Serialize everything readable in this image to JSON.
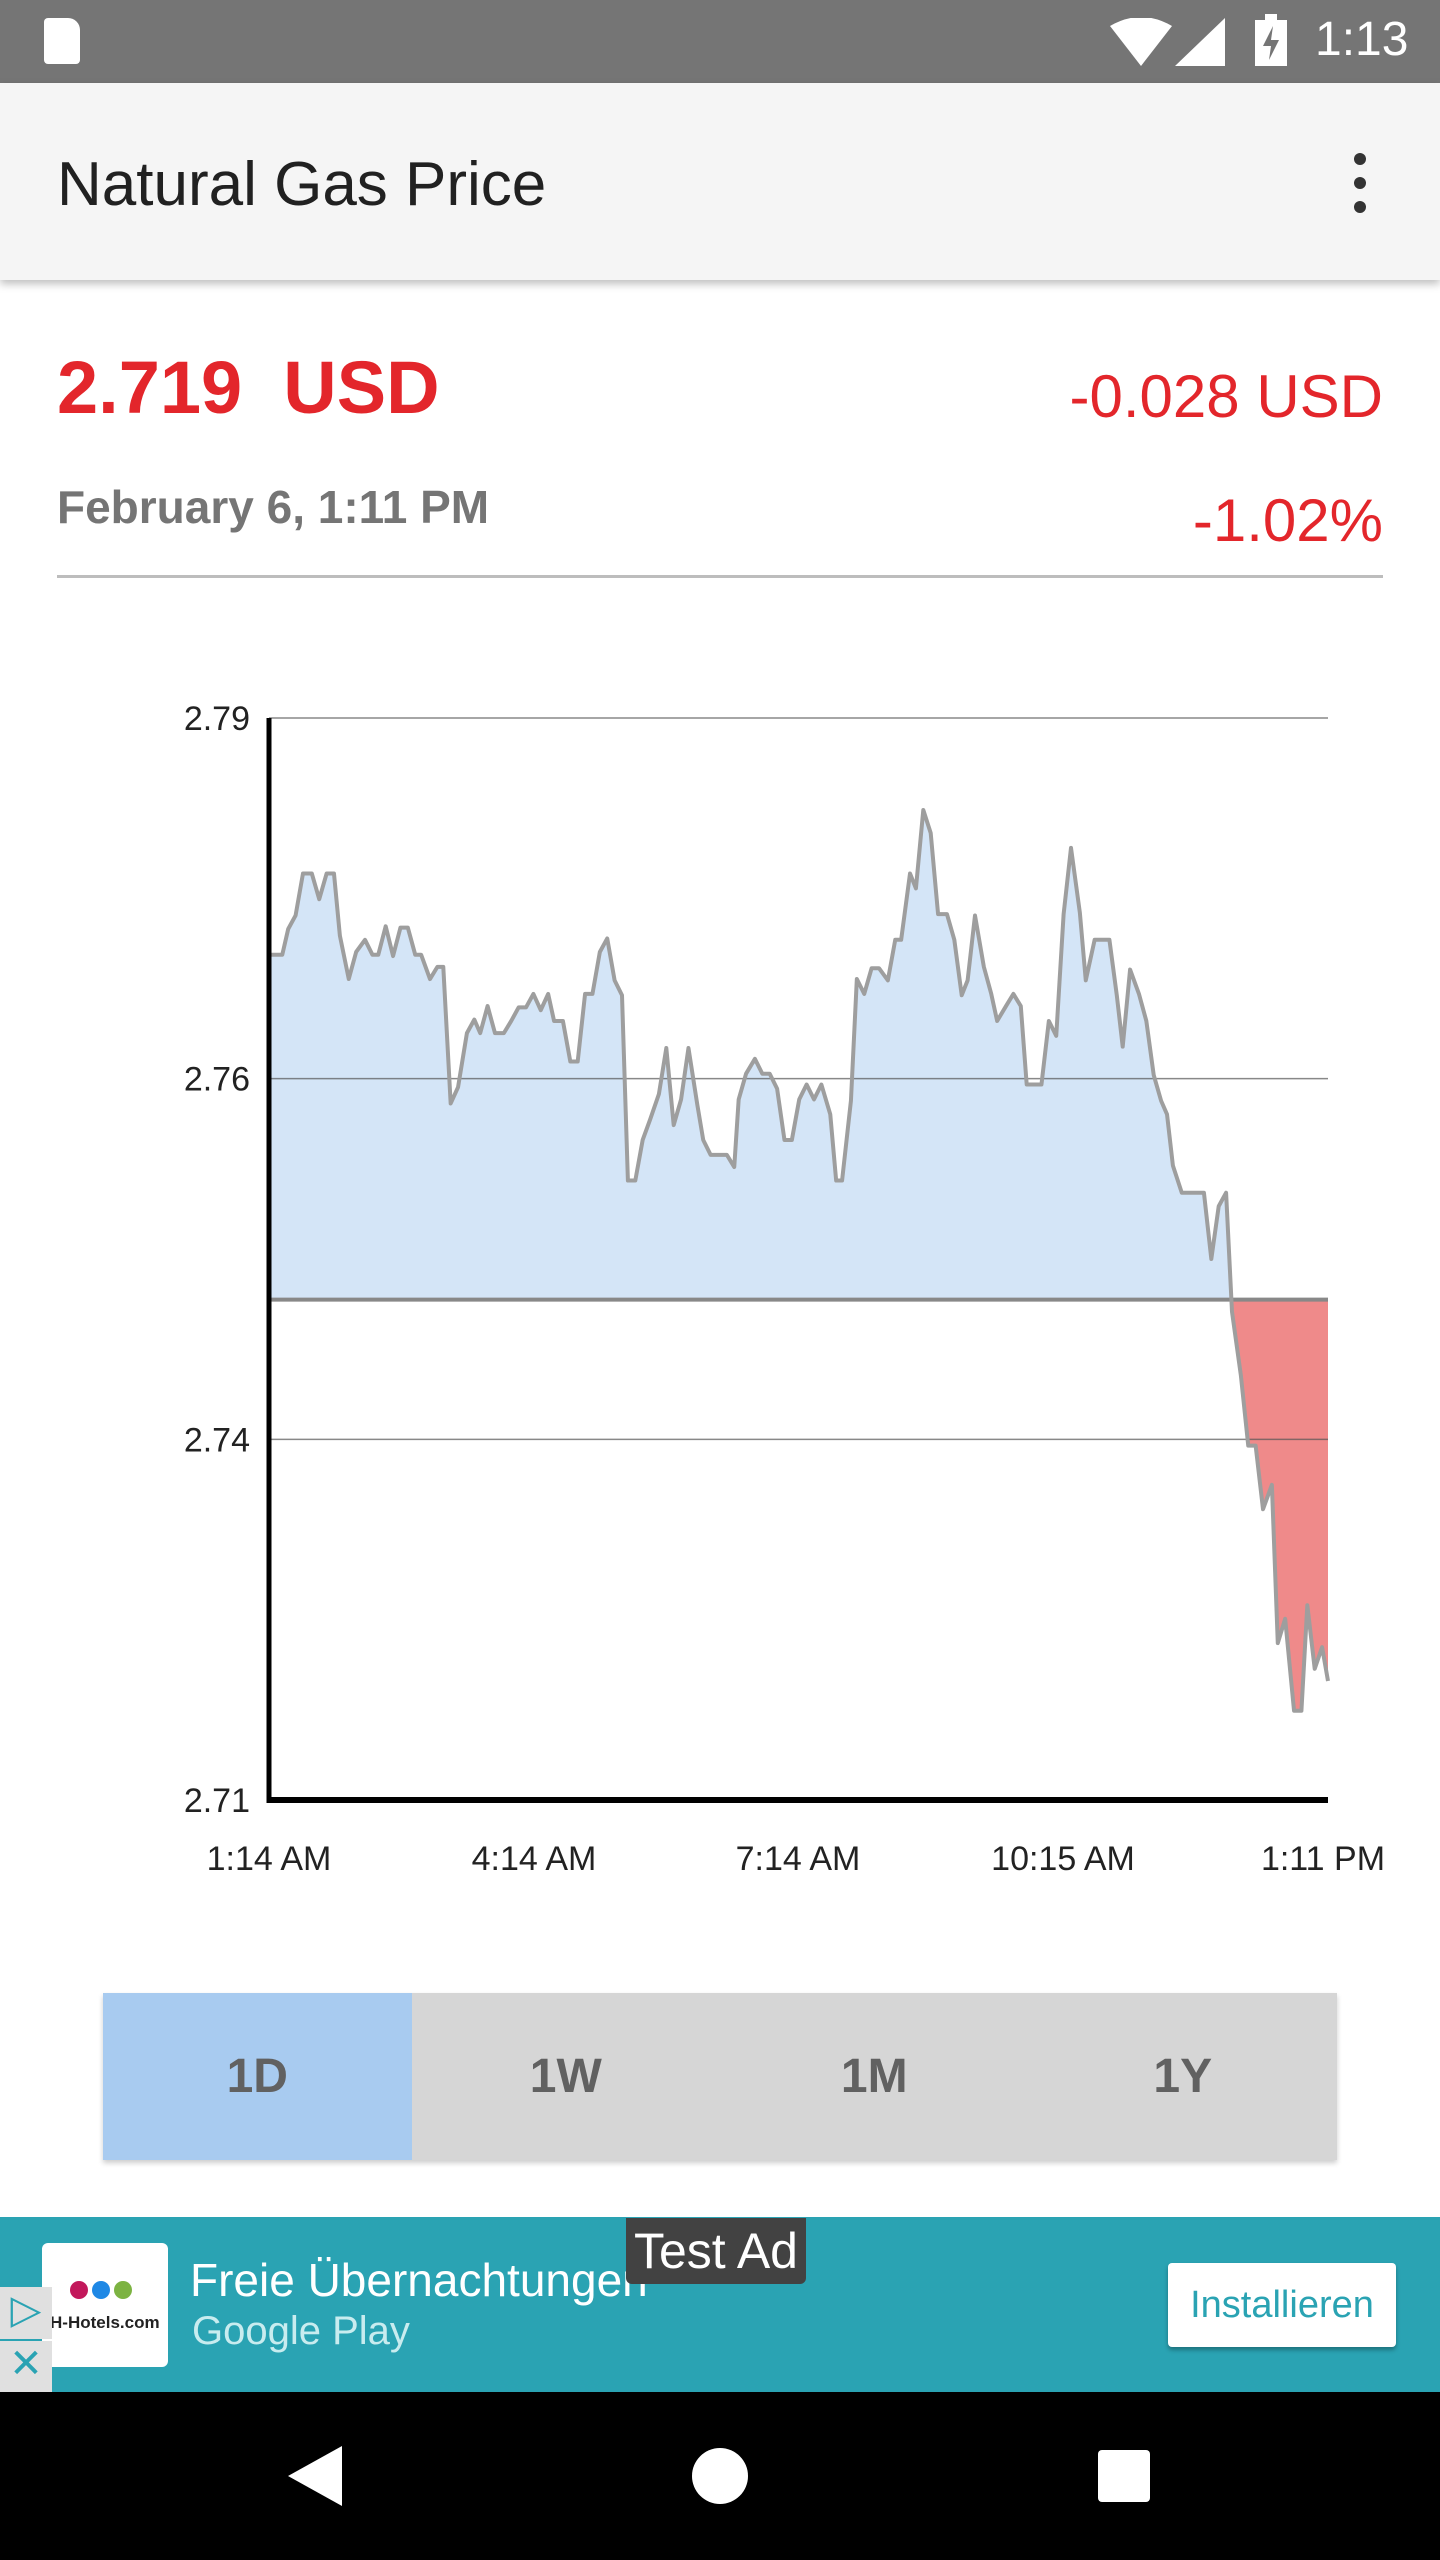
{
  "status_bar": {
    "time": "1:13",
    "icons": [
      "sd-card-icon",
      "wifi-icon",
      "signal-icon",
      "battery-charging-icon"
    ]
  },
  "app_bar": {
    "title": "Natural Gas Price",
    "menu_icon": "more-vert-icon"
  },
  "quote": {
    "price": "2.719  USD",
    "change": "-0.028 USD",
    "date": "February 6, 1:11 PM",
    "percent": "-1.02%",
    "color": "#e3262b"
  },
  "range_buttons": [
    {
      "label": "1D",
      "active": true
    },
    {
      "label": "1W",
      "active": false
    },
    {
      "label": "1M",
      "active": false
    },
    {
      "label": "1Y",
      "active": false
    }
  ],
  "ad": {
    "badge": "Test Ad",
    "headline": "Freie Übernachtungen",
    "store": "Google Play",
    "button": "Installieren",
    "logo_text": "H-Hotels.com",
    "bg_color": "#2aa3b3"
  },
  "chart_data": {
    "type": "area",
    "baseline": 2.747,
    "ylim": [
      2.71,
      2.79
    ],
    "y_ticks": [
      "2.79",
      "2.76",
      "2.74",
      "2.71"
    ],
    "x_ticks": [
      "1:14 AM",
      "4:14 AM",
      "7:14 AM",
      "10:15 AM",
      "1:11 PM"
    ],
    "x_range": [
      "01:14",
      "13:11"
    ],
    "above_color": "#d4e5f7",
    "below_color": "#ef8a8a",
    "line_color": "#9e9e9e",
    "grid": true,
    "x": [
      "01:14",
      "01:23",
      "01:27",
      "01:32",
      "01:37",
      "01:43",
      "01:48",
      "01:53",
      "01:58",
      "02:02",
      "02:08",
      "02:13",
      "02:19",
      "02:24",
      "02:28",
      "02:33",
      "02:38",
      "02:43",
      "02:48",
      "02:53",
      "02:57",
      "03:03",
      "03:08",
      "03:12",
      "03:17",
      "03:22",
      "03:28",
      "03:33",
      "03:37",
      "03:42",
      "03:47",
      "03:53",
      "03:58",
      "04:03",
      "04:08",
      "04:13",
      "04:18",
      "04:23",
      "04:27",
      "04:33",
      "04:38",
      "04:43",
      "04:48",
      "04:53",
      "04:58",
      "05:03",
      "05:08",
      "05:13",
      "05:17",
      "05:22",
      "05:27",
      "05:32",
      "05:38",
      "05:43",
      "05:48",
      "05:53",
      "05:58",
      "06:04",
      "06:08",
      "06:13",
      "06:24",
      "06:29",
      "06:32",
      "06:37",
      "06:43",
      "06:48",
      "06:53",
      "06:58",
      "07:03",
      "07:08",
      "07:13",
      "07:18",
      "07:23",
      "07:28",
      "07:34",
      "07:38",
      "07:42",
      "07:48",
      "07:52",
      "07:57",
      "08:02",
      "08:07",
      "08:13",
      "08:18",
      "08:22",
      "08:28",
      "08:32",
      "08:37",
      "08:42",
      "08:47",
      "08:53",
      "08:58",
      "09:03",
      "09:07",
      "09:12",
      "09:18",
      "09:23",
      "09:27",
      "09:33",
      "09:38",
      "09:43",
      "09:47",
      "09:57",
      "10:02",
      "10:07",
      "10:12",
      "10:17",
      "10:23",
      "10:27",
      "10:33",
      "10:43",
      "10:48",
      "10:52",
      "10:57",
      "11:03",
      "11:08",
      "11:13",
      "11:18",
      "11:22",
      "11:26",
      "11:32",
      "11:47",
      "11:52",
      "11:57",
      "12:02",
      "12:06",
      "12:12",
      "12:17",
      "12:22",
      "12:27",
      "12:33",
      "12:37",
      "12:42",
      "12:48",
      "12:53",
      "12:57",
      "13:02",
      "13:07",
      "13:11"
    ],
    "values": [
      2.7725,
      2.7725,
      2.7744,
      2.7754,
      2.7785,
      2.7785,
      2.7766,
      2.7785,
      2.7785,
      2.7739,
      2.7707,
      2.7727,
      2.7736,
      2.7725,
      2.7725,
      2.7746,
      2.7724,
      2.7745,
      2.7745,
      2.7725,
      2.7725,
      2.7707,
      2.7716,
      2.7716,
      2.7615,
      2.7627,
      2.7667,
      2.7677,
      2.7667,
      2.7687,
      2.7667,
      2.7667,
      2.7676,
      2.7686,
      2.7686,
      2.7696,
      2.7684,
      2.7696,
      2.7676,
      2.7676,
      2.7646,
      2.7646,
      2.7696,
      2.7696,
      2.7727,
      2.7737,
      2.7706,
      2.7695,
      2.7558,
      2.7558,
      2.7588,
      2.7603,
      2.7622,
      2.7656,
      2.7599,
      2.7618,
      2.7656,
      2.7614,
      2.7588,
      2.7577,
      2.7577,
      2.7568,
      2.7618,
      2.7637,
      2.7648,
      2.7637,
      2.7637,
      2.7626,
      2.7588,
      2.7588,
      2.7618,
      2.7629,
      2.7618,
      2.7629,
      2.7607,
      2.7558,
      2.7558,
      2.7617,
      2.7707,
      2.7696,
      2.7715,
      2.7715,
      2.7706,
      2.7736,
      2.7736,
      2.7785,
      2.7774,
      2.7832,
      2.7815,
      2.7755,
      2.7755,
      2.7736,
      2.7695,
      2.7706,
      2.7754,
      2.7716,
      2.7696,
      2.7676,
      2.7687,
      2.7696,
      2.7687,
      2.7629,
      2.7629,
      2.7676,
      2.7665,
      2.7755,
      2.7804,
      2.7756,
      2.7706,
      2.7736,
      2.7736,
      2.7695,
      2.7657,
      2.7714,
      2.7696,
      2.7676,
      2.7636,
      2.7617,
      2.7607,
      2.7569,
      2.7549,
      2.7549,
      2.75,
      2.7539,
      2.7549,
      2.7461,
      2.7414,
      2.7362,
      2.7362,
      2.7315,
      2.7333,
      2.7216,
      2.7234,
      2.7166,
      2.7166,
      2.7244,
      2.7197,
      2.7213,
      2.7188
    ]
  }
}
